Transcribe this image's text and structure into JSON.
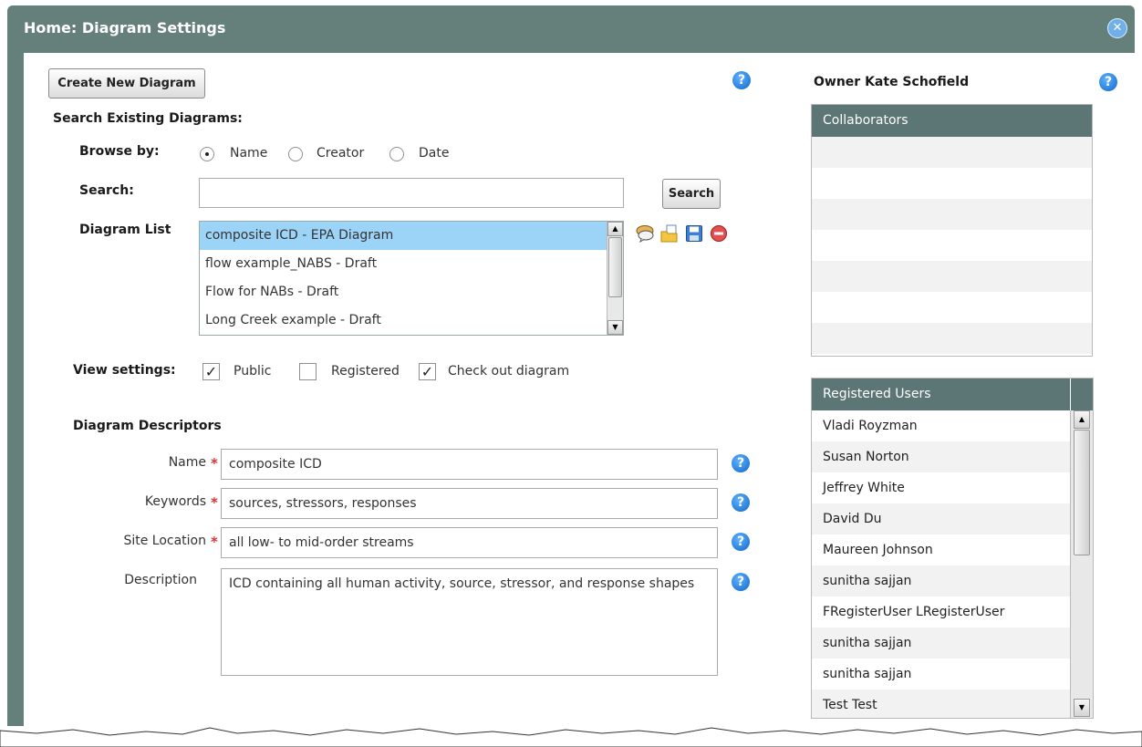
{
  "window": {
    "title": "Home: Diagram Settings",
    "close_symbol": "✕"
  },
  "colors": {
    "titlebar": "#657f7b",
    "selected_row": "#9cd4f8",
    "column_header": "#5b7674",
    "help": "#1a7bd6",
    "required": "#dd3333"
  },
  "toolbar": {
    "create_label": "Create New Diagram"
  },
  "search_section": {
    "heading": "Search Existing Diagrams:",
    "browse_label": "Browse by:",
    "browse_options": [
      "Name",
      "Creator",
      "Date"
    ],
    "browse_selected": "Name",
    "search_label": "Search:",
    "search_value": "",
    "search_button": "Search",
    "list_label": "Diagram List",
    "diagrams": [
      "composite ICD - EPA Diagram",
      "flow example_NABS - Draft",
      "Flow for NABs - Draft",
      "Long Creek example - Draft"
    ],
    "selected_diagram": "composite ICD - EPA Diagram",
    "tool_icons": [
      "chat-icon",
      "open-folder-icon",
      "save-icon",
      "delete-icon"
    ]
  },
  "view_settings": {
    "label": "View settings:",
    "options": [
      {
        "label": "Public",
        "checked": true
      },
      {
        "label": "Registered",
        "checked": false
      },
      {
        "label": "Check out diagram",
        "checked": true
      }
    ]
  },
  "descriptors": {
    "heading": "Diagram Descriptors",
    "required_mark": "*",
    "name_label": "Name",
    "name_value": "composite ICD",
    "keywords_label": "Keywords",
    "keywords_value": "sources, stressors, responses",
    "site_label": "Site Location",
    "site_value": "all low- to mid-order streams",
    "description_label": "Description",
    "description_value": "ICD containing all human activity, source, stressor, and response shapes"
  },
  "help_symbol": "?",
  "owner": {
    "label": "Owner",
    "name": "Kate Schofield"
  },
  "collaborators": {
    "header": "Collaborators",
    "items": []
  },
  "registered_users": {
    "header": "Registered Users",
    "items": [
      "Vladi Royzman",
      "Susan Norton",
      "Jeffrey White",
      "David Du",
      "Maureen Johnson",
      "sunitha sajjan",
      "FRegisterUser LRegisterUser",
      "sunitha sajjan",
      "sunitha sajjan",
      "Test Test"
    ]
  }
}
